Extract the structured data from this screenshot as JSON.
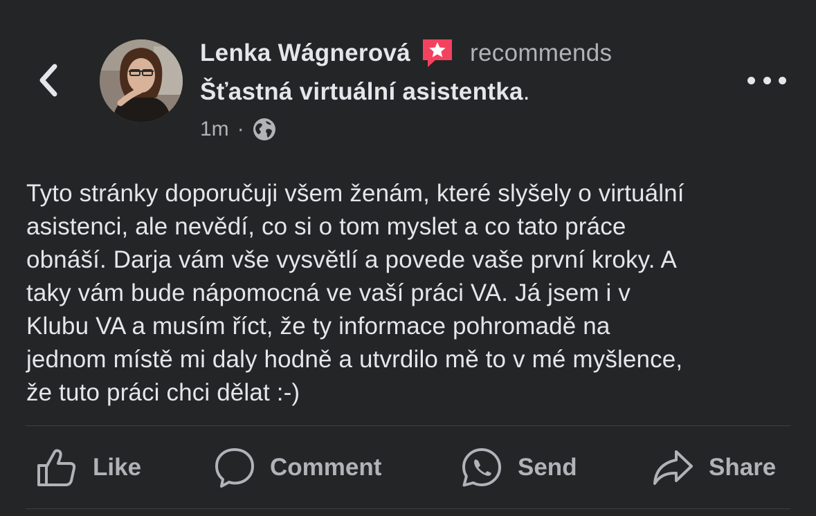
{
  "header": {
    "author": "Lenka Wágnerová",
    "action_text": "recommends",
    "page_name": "Šťastná virtuální asistentka",
    "period": ".",
    "time": "1m",
    "separator": "·",
    "audience_icon": "globe-icon",
    "recommend_icon": "recommendation-star-icon",
    "back_icon": "chevron-left-icon",
    "more_icon": "more-horizontal-icon",
    "recommend_color": "#f3425f"
  },
  "post": {
    "lines": [
      "Tyto stránky doporučuji všem ženám, které slyšely o virtuální",
      "asistenci, ale nevědí, co si o tom myslet a co tato práce",
      "obnáší. Darja vám vše vysvětlí a povede vaše první kroky. A",
      "taky vám bude nápomocná ve vaší práci VA. Já jsem i v",
      "Klubu VA a musím říct, že ty informace pohromadě na",
      "jednom místě mi daly hodně a utvrdilo mě to v mé myšlence,",
      "že tuto práci chci dělat :-)"
    ]
  },
  "actions": {
    "like": "Like",
    "comment": "Comment",
    "send": "Send",
    "share": "Share"
  },
  "colors": {
    "background": "#242526",
    "primary_text": "#e4e6eb",
    "secondary_text": "#b0b3b8",
    "divider": "#3e4042"
  }
}
